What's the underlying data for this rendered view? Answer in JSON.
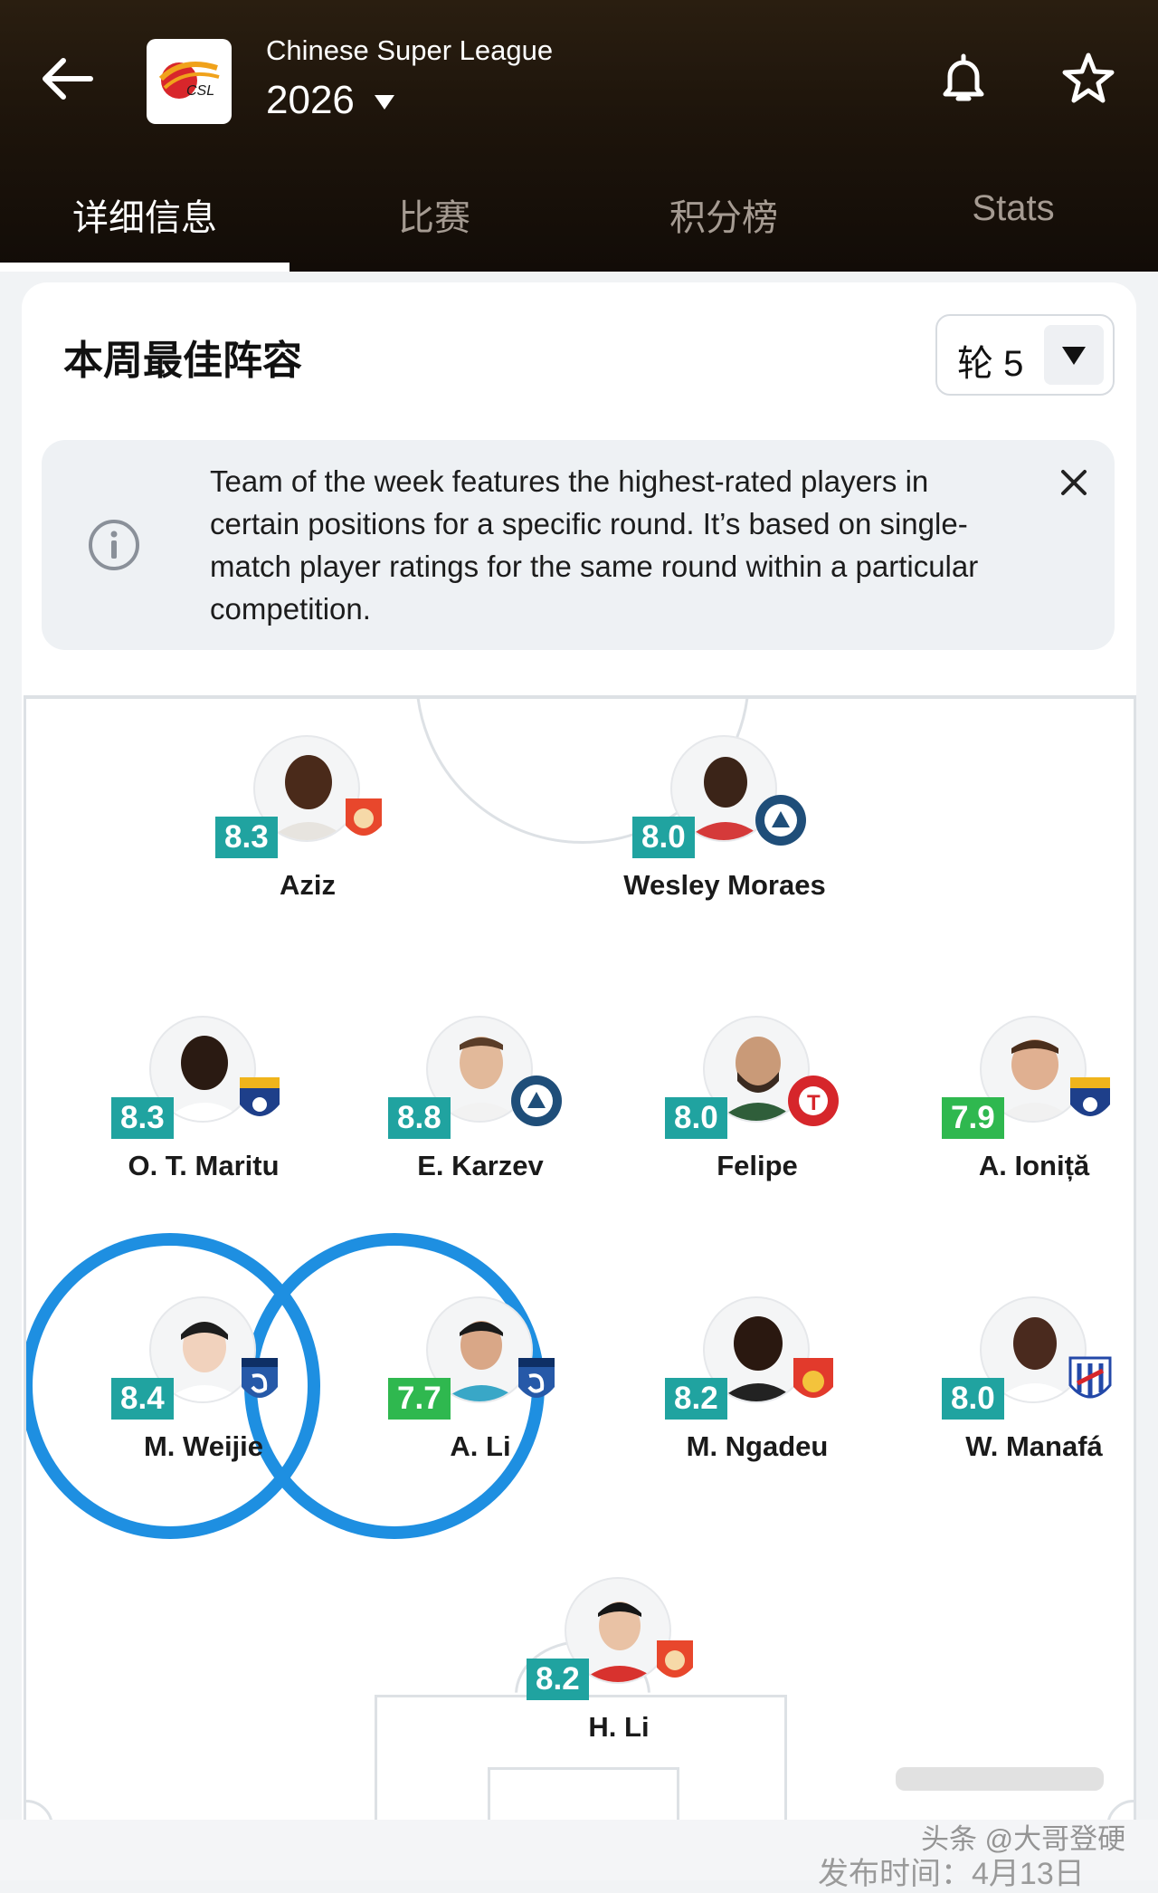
{
  "header": {
    "league_name": "Chinese Super League",
    "season": "2026",
    "logo_text": "CSL"
  },
  "tabs": [
    {
      "label": "详细信息",
      "active": true
    },
    {
      "label": "比赛",
      "active": false
    },
    {
      "label": "积分榜",
      "active": false
    },
    {
      "label": "Stats",
      "active": false
    }
  ],
  "section": {
    "title": "本周最佳阵容",
    "round_label": "轮 5"
  },
  "info": {
    "text": "Team of the week features the highest-rated players in certain positions for a specific round. It’s based on single-match player ratings for the same round within a particular competition."
  },
  "colors": {
    "rating_teal": "#20a3a0",
    "rating_green": "#2fb84f",
    "highlight": "#1e8fe1"
  },
  "players": {
    "aziz": {
      "name": "Aziz",
      "rating": "8.3",
      "club_icon": "zhejiang-crest-icon"
    },
    "moraes": {
      "name": "Wesley Moraes",
      "rating": "8.0",
      "club_icon": "shenzhen-crest-icon"
    },
    "maritu": {
      "name": "O. T. Maritu",
      "rating": "8.3",
      "club_icon": "ynyk-crest-icon"
    },
    "karzev": {
      "name": "E. Karzev",
      "rating": "8.8",
      "club_icon": "shenzhen-crest-icon"
    },
    "felipe": {
      "name": "Felipe",
      "rating": "8.0",
      "club_icon": "liaoning-crest-icon"
    },
    "ionita": {
      "name": "A. Ioniță",
      "rating": "7.9",
      "club_icon": "ynyk-crest-icon"
    },
    "weijie": {
      "name": "M. Weijie",
      "rating": "8.4",
      "club_icon": "dalian-crest-icon"
    },
    "ali": {
      "name": "A. Li",
      "rating": "7.7",
      "club_icon": "dalian-crest-icon"
    },
    "ngadeu": {
      "name": "M. Ngadeu",
      "rating": "8.2",
      "club_icon": "chengdu-crest-icon"
    },
    "manafa": {
      "name": "W. Manafá",
      "rating": "8.0",
      "club_icon": "shanghai-shenhua-crest-icon"
    },
    "hli": {
      "name": "H. Li",
      "rating": "8.2",
      "club_icon": "zhejiang-crest-icon"
    }
  },
  "watermark": {
    "source": "头条 @大哥登硬",
    "date": "发布时间：4月13日"
  }
}
